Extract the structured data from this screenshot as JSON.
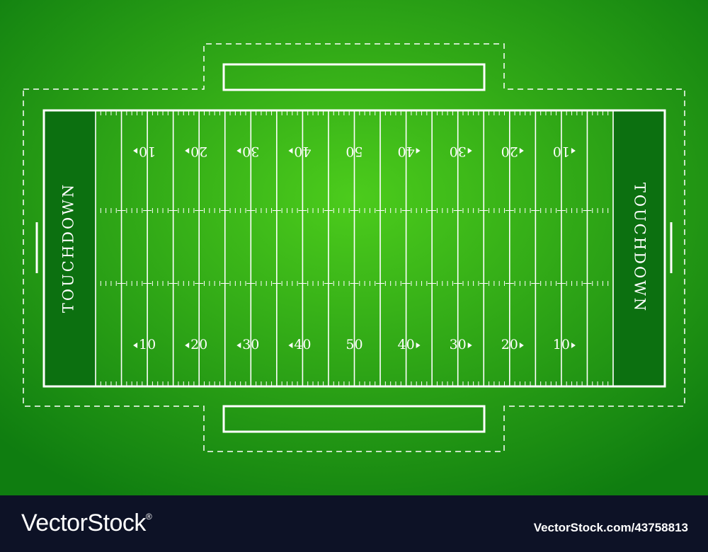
{
  "field": {
    "endzone_left_label": "TOUCHDOWN",
    "endzone_right_label": "TOUCHDOWN",
    "yard_numbers_top": [
      "10",
      "20",
      "30",
      "40",
      "50",
      "40",
      "30",
      "20",
      "10"
    ],
    "yard_numbers_bottom": [
      "10",
      "20",
      "30",
      "40",
      "50",
      "40",
      "30",
      "20",
      "10"
    ],
    "colors": {
      "field_center": "#4ccc1c",
      "field_edge": "#0f7d10",
      "endzone": "#0c7010",
      "lines": "#ffffff"
    }
  },
  "footer": {
    "brand": "VectorStock",
    "brand_mark": "®",
    "image_id": "VectorStock.com/43758813"
  }
}
